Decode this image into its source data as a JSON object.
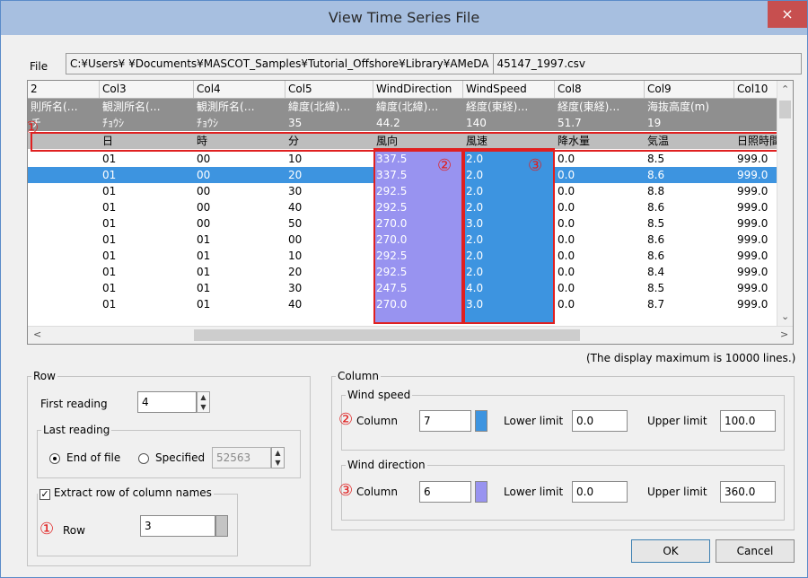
{
  "window": {
    "title": "View Time Series File",
    "close_glyph": "×"
  },
  "file": {
    "label": "File",
    "path": "C:¥Users¥      ¥Documents¥MASCOT_Samples¥Tutorial_Offshore¥Library¥AMeDA",
    "filename": "45147_1997.csv"
  },
  "grid": {
    "headers": [
      "2",
      "Col3",
      "Col4",
      "Col5",
      "WindDirection",
      "WindSpeed",
      "Col8",
      "Col9",
      "Col10"
    ],
    "meta_rows": [
      [
        "則所名(…",
        "観測所名(…",
        "観測所名(…",
        "緯度(北緯)…",
        "緯度(北緯)…",
        "経度(東経)…",
        "経度(東経)…",
        "海抜高度(m)",
        ""
      ],
      [
        "チ",
        "ﾁｮｳｼ",
        "ﾁｮｳｼ",
        "35",
        "44.2",
        "140",
        "51.7",
        "19",
        ""
      ]
    ],
    "name_row": [
      "",
      "日",
      "時",
      "分",
      "風向",
      "風速",
      "降水量",
      "気温",
      "日照時間"
    ],
    "rows": [
      [
        "",
        "01",
        "00",
        "10",
        "337.5",
        "2.0",
        "0.0",
        "8.5",
        "999.0"
      ],
      [
        "",
        "01",
        "00",
        "20",
        "337.5",
        "2.0",
        "0.0",
        "8.6",
        "999.0"
      ],
      [
        "",
        "01",
        "00",
        "30",
        "292.5",
        "2.0",
        "0.0",
        "8.8",
        "999.0"
      ],
      [
        "",
        "01",
        "00",
        "40",
        "292.5",
        "2.0",
        "0.0",
        "8.6",
        "999.0"
      ],
      [
        "",
        "01",
        "00",
        "50",
        "270.0",
        "3.0",
        "0.0",
        "8.5",
        "999.0"
      ],
      [
        "",
        "01",
        "01",
        "00",
        "270.0",
        "2.0",
        "0.0",
        "8.6",
        "999.0"
      ],
      [
        "",
        "01",
        "01",
        "10",
        "292.5",
        "2.0",
        "0.0",
        "8.6",
        "999.0"
      ],
      [
        "",
        "01",
        "01",
        "20",
        "292.5",
        "2.0",
        "0.0",
        "8.4",
        "999.0"
      ],
      [
        "",
        "01",
        "01",
        "30",
        "247.5",
        "4.0",
        "0.0",
        "8.5",
        "999.0"
      ],
      [
        "",
        "01",
        "01",
        "40",
        "270.0",
        "3.0",
        "0.0",
        "8.7",
        "999.0"
      ]
    ],
    "selected_row": 1,
    "annotations": {
      "names_row": "①",
      "wind_direction": "②",
      "wind_speed": "③"
    }
  },
  "display_max_note": "(The display maximum is 10000 lines.)",
  "row_group": {
    "label": "Row",
    "first_reading_label": "First reading",
    "first_reading_value": "4",
    "last_reading_label": "Last reading",
    "end_of_file_label": "End of file",
    "specified_label": "Specified",
    "specified_value": "52563",
    "extract_label": "Extract row of column names",
    "row_label": "Row",
    "row_value": "3",
    "annotation": "①"
  },
  "column_group": {
    "label": "Column",
    "wind_speed": {
      "label": "Wind speed",
      "column_label": "Column",
      "column_value": "7",
      "lower_label": "Lower limit",
      "lower_value": "0.0",
      "upper_label": "Upper limit",
      "upper_value": "100.0",
      "color": "#3d94e0",
      "annotation": "②"
    },
    "wind_direction": {
      "label": "Wind direction",
      "column_label": "Column",
      "column_value": "6",
      "lower_label": "Lower limit",
      "lower_value": "0.0",
      "upper_label": "Upper limit",
      "upper_value": "360.0",
      "color": "#9893f0",
      "annotation": "③"
    }
  },
  "buttons": {
    "ok": "OK",
    "cancel": "Cancel"
  }
}
